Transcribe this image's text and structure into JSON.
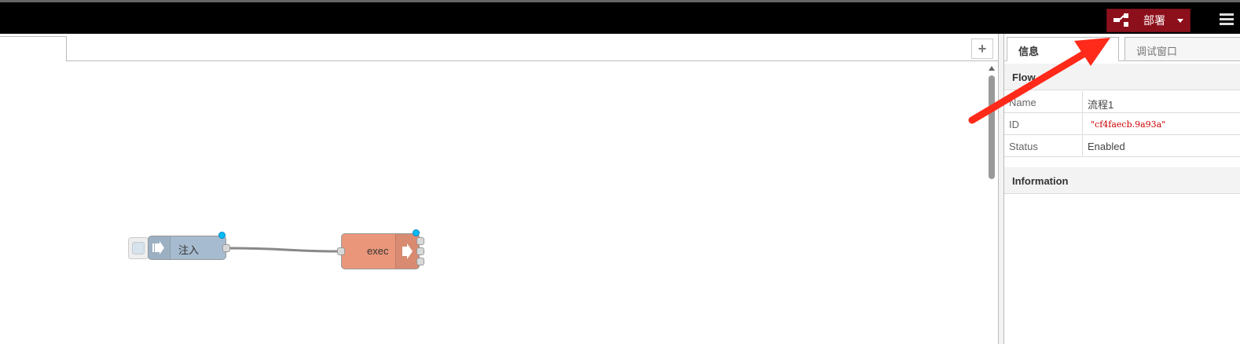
{
  "header": {
    "deploy_label": "部署",
    "deploy_icon": "deploy-icon",
    "menu_icon": "hamburger-icon",
    "accent": "#8c101c"
  },
  "workspace": {
    "add_tab_label": "+",
    "nodes": [
      {
        "type": "inject",
        "label": "注入",
        "color": "#a6bbcf"
      },
      {
        "type": "exec",
        "label": "exec",
        "color": "#e9967a"
      }
    ]
  },
  "sidebar": {
    "tabs": [
      "信息",
      "调试窗口"
    ],
    "flow_section": "Flow",
    "props": [
      {
        "key": "Name",
        "value": "流程1"
      },
      {
        "key": "ID",
        "value": "\"cf4faecb.9a93a\""
      },
      {
        "key": "Status",
        "value": "Enabled"
      }
    ],
    "info_section": "Information"
  },
  "annotation": {
    "color": "#ff2a1a"
  }
}
